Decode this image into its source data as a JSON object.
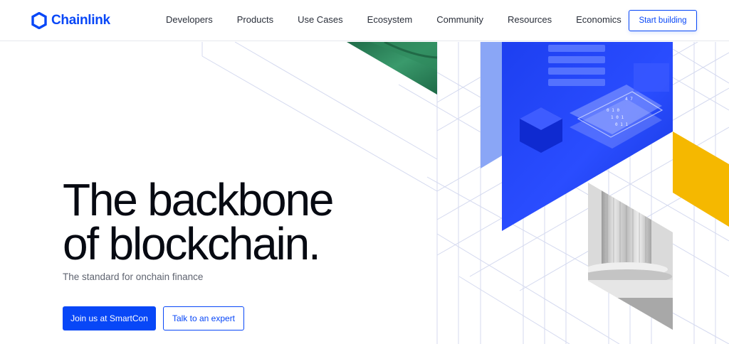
{
  "brand": {
    "name": "Chainlink",
    "color": "#0847f7"
  },
  "nav": {
    "items": [
      {
        "label": "Developers"
      },
      {
        "label": "Products"
      },
      {
        "label": "Use Cases"
      },
      {
        "label": "Ecosystem"
      },
      {
        "label": "Community"
      },
      {
        "label": "Resources"
      },
      {
        "label": "Economics"
      }
    ],
    "cta_label": "Start building"
  },
  "hero": {
    "headline_line1": "The backbone",
    "headline_line2": "of blockchain.",
    "subtitle": "The standard for onchain finance",
    "primary_button": "Join us at SmartCon",
    "secondary_button": "Talk to an expert"
  },
  "colors": {
    "accent_blue": "#0847f7",
    "green": "#2a7f5a",
    "yellow": "#f5b800",
    "light_blue": "#8aa6f6",
    "grid_line": "#d4d9ef"
  },
  "artwork": {
    "panels": [
      "green-panel",
      "blue-data-panel",
      "light-blue-panel",
      "yellow-panel",
      "pillar-photo-panel"
    ]
  }
}
